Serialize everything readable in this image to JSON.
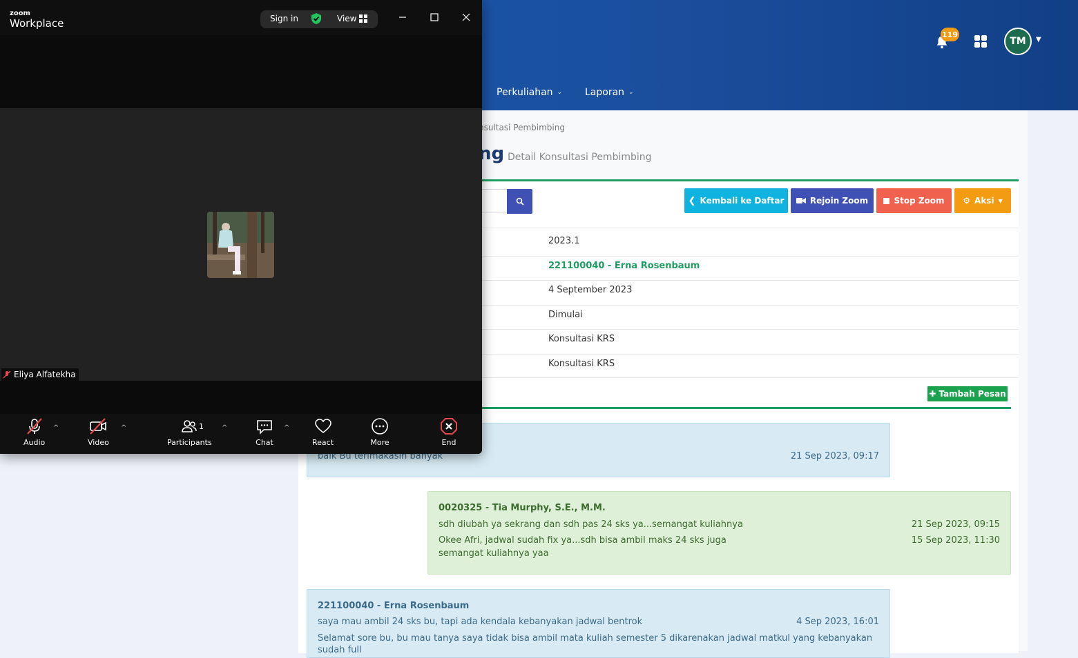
{
  "web": {
    "nav": [
      {
        "label": "Perkuliahan"
      },
      {
        "label": "Laporan"
      }
    ],
    "notifications": {
      "count": "119"
    },
    "user": {
      "initials": "TM"
    },
    "breadcrumb": "nsultasi Pembimbing",
    "page_title": "ng",
    "page_subtitle": "Detail Konsultasi Pembimbing",
    "buttons": {
      "back": "Kembali ke Daftar",
      "rejoin": "Rejoin Zoom",
      "stop": "Stop Zoom",
      "action": "Aksi",
      "add_message": "Tambah Pesan"
    },
    "details": [
      {
        "value": "2023.1"
      },
      {
        "value": "221100040 - Erna Rosenbaum"
      },
      {
        "value": "4 September 2023"
      },
      {
        "value": "Dimulai"
      },
      {
        "value": "Konsultasi KRS"
      },
      {
        "value": "Konsultasi KRS"
      }
    ],
    "messages": [
      {
        "lines": [
          {
            "text": "baik Bu terimakasih banyak",
            "time": "21 Sep 2023, 09:17"
          }
        ]
      },
      {
        "sender": "0020325 - Tia Murphy, S.E., M.M.",
        "lines": [
          {
            "text": "sdh diubah ya sekrang dan sdh pas 24 sks ya...semangat kuliahnya",
            "time": "21 Sep 2023, 09:15"
          },
          {
            "text": "Okee Afri, jadwal sudah fix ya...sdh bisa ambil maks 24 sks juga",
            "time": "15 Sep 2023, 11:30"
          },
          {
            "text": "semangat kuliahnya yaa"
          }
        ]
      },
      {
        "sender": "221100040 - Erna Rosenbaum",
        "lines": [
          {
            "text": "saya mau ambil 24 sks bu, tapi ada kendala kebanyakan jadwal bentrok",
            "time": "4 Sep 2023, 16:01"
          },
          {
            "text": "Selamat sore bu, bu mau tanya saya tidak bisa ambil mata kuliah semester 5 dikarenakan jadwal matkul yang kebanyakan"
          },
          {
            "text": "sudah full"
          }
        ]
      }
    ]
  },
  "zoom": {
    "brand_small": "zoom",
    "brand": "Workplace",
    "sign_in": "Sign in",
    "view": "View",
    "participant_name": "Eliya Alfatekha",
    "participant_count": "1",
    "toolbar": {
      "audio": "Audio",
      "video": "Video",
      "participants": "Participants",
      "chat": "Chat",
      "react": "React",
      "more": "More",
      "end": "End"
    }
  },
  "colors": {
    "nav_blue": "#1c5bb3",
    "green": "#1e9d62",
    "back_btn": "#0fb3e0",
    "rejoin_btn": "#3f51b5",
    "stop_btn": "#f0614e",
    "action_btn": "#f39c12"
  }
}
